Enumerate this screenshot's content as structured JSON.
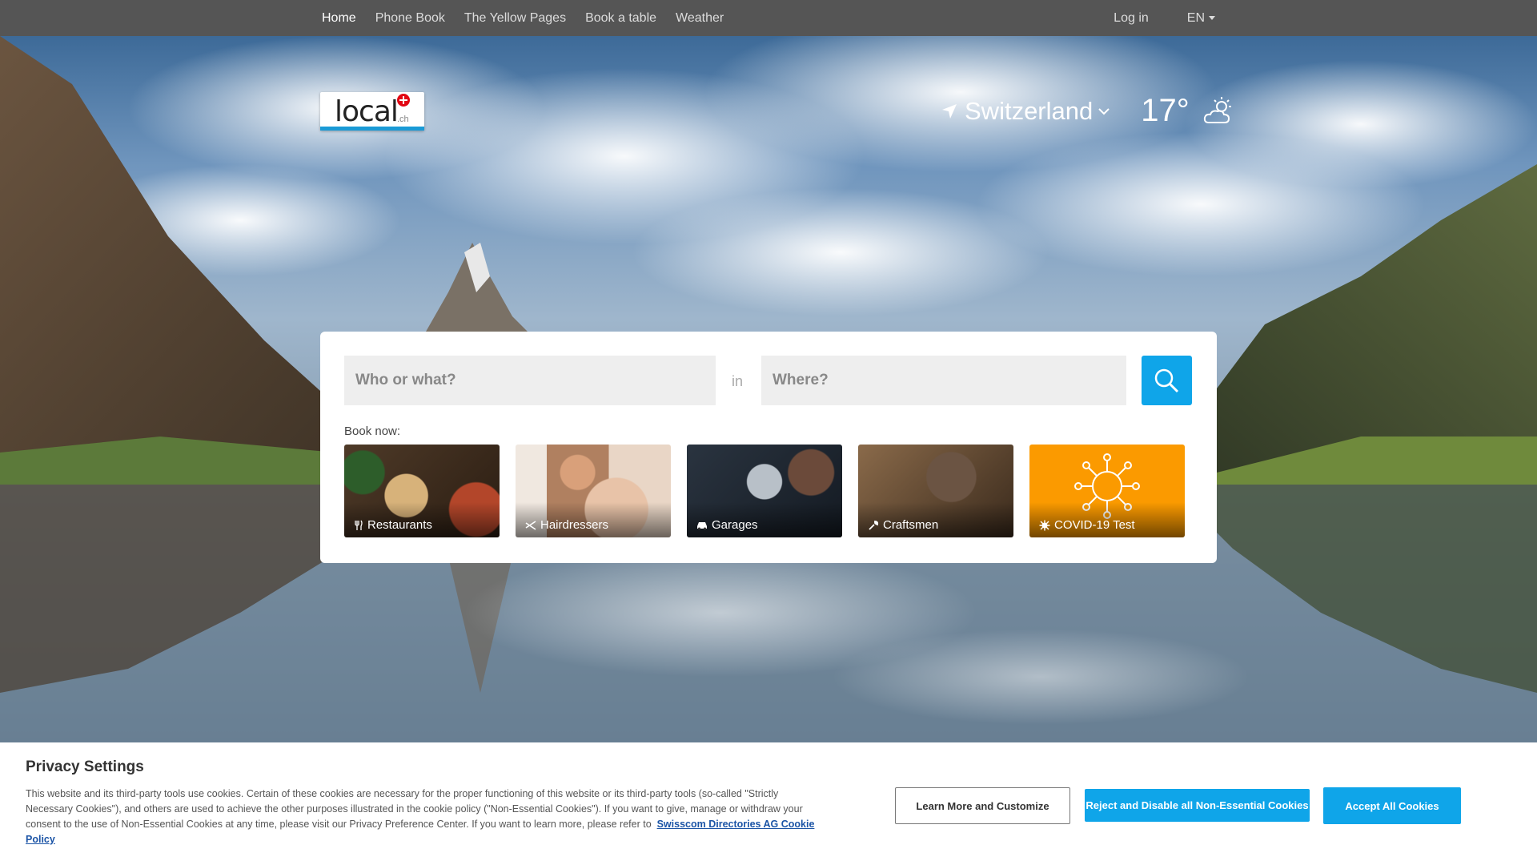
{
  "nav": {
    "items": [
      "Home",
      "Phone Book",
      "The Yellow Pages",
      "Book a table",
      "Weather"
    ],
    "login": "Log in",
    "language": "EN"
  },
  "logo": {
    "word": "local",
    "suffix": ".ch"
  },
  "location": {
    "name": "Switzerland",
    "temperature": "17°",
    "weather_icon": "partly-cloudy-icon"
  },
  "search": {
    "who_placeholder": "Who or what?",
    "in_label": "in",
    "where_placeholder": "Where?",
    "book_now": "Book now:",
    "tiles": [
      {
        "label": "Restaurants",
        "icon": "fork-knife-icon"
      },
      {
        "label": "Hairdressers",
        "icon": "scissors-icon"
      },
      {
        "label": "Garages",
        "icon": "car-icon"
      },
      {
        "label": "Craftsmen",
        "icon": "wrench-icon"
      },
      {
        "label": "COVID-19 Test",
        "icon": "virus-icon"
      }
    ]
  },
  "cookie": {
    "title": "Privacy Settings",
    "text": "This website and its third-party tools use cookies. Certain of these cookies are necessary for the proper functioning of this website or its third-party tools (so-called \"Strictly Necessary Cookies\"), and others are used to achieve the other purposes illustrated in the cookie policy (\"Non-Essential Cookies\"). If you want to give, manage or withdraw your consent to the use of Non-Essential Cookies at any time, please visit our Privacy Preference Center. If you want to learn more, please refer to",
    "link": "Swisscom Directories AG Cookie Policy",
    "learn_more": "Learn More and Customize",
    "reject": "Reject and Disable all Non-Essential Cookies",
    "accept": "Accept All Cookies"
  },
  "colors": {
    "accent": "#0fa5e9",
    "covid_tile": "#fb9a00",
    "topbar": "#555555"
  }
}
